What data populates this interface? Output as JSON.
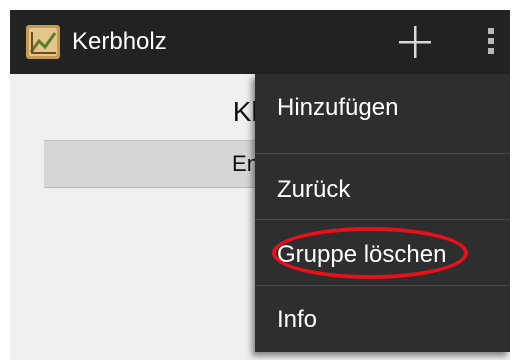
{
  "app": {
    "title": "Kerbholz",
    "icon": "kerbholz-app-icon"
  },
  "action_bar": {
    "add_icon": "plus-icon",
    "overflow_icon": "vertical-ellipsis-icon"
  },
  "content": {
    "title": "Klas",
    "group_label": "Englis"
  },
  "menu": {
    "items": [
      {
        "label": "Hinzufügen"
      },
      {
        "label": "Zurück"
      },
      {
        "label": "Gruppe löschen"
      },
      {
        "label": "Info"
      }
    ]
  },
  "annotation": {
    "highlight_color": "#e8101a",
    "highlighted_item": "Gruppe löschen"
  },
  "colors": {
    "action_bar_bg": "#222222",
    "menu_bg": "#2e2e2e",
    "content_bg": "#efefef"
  }
}
